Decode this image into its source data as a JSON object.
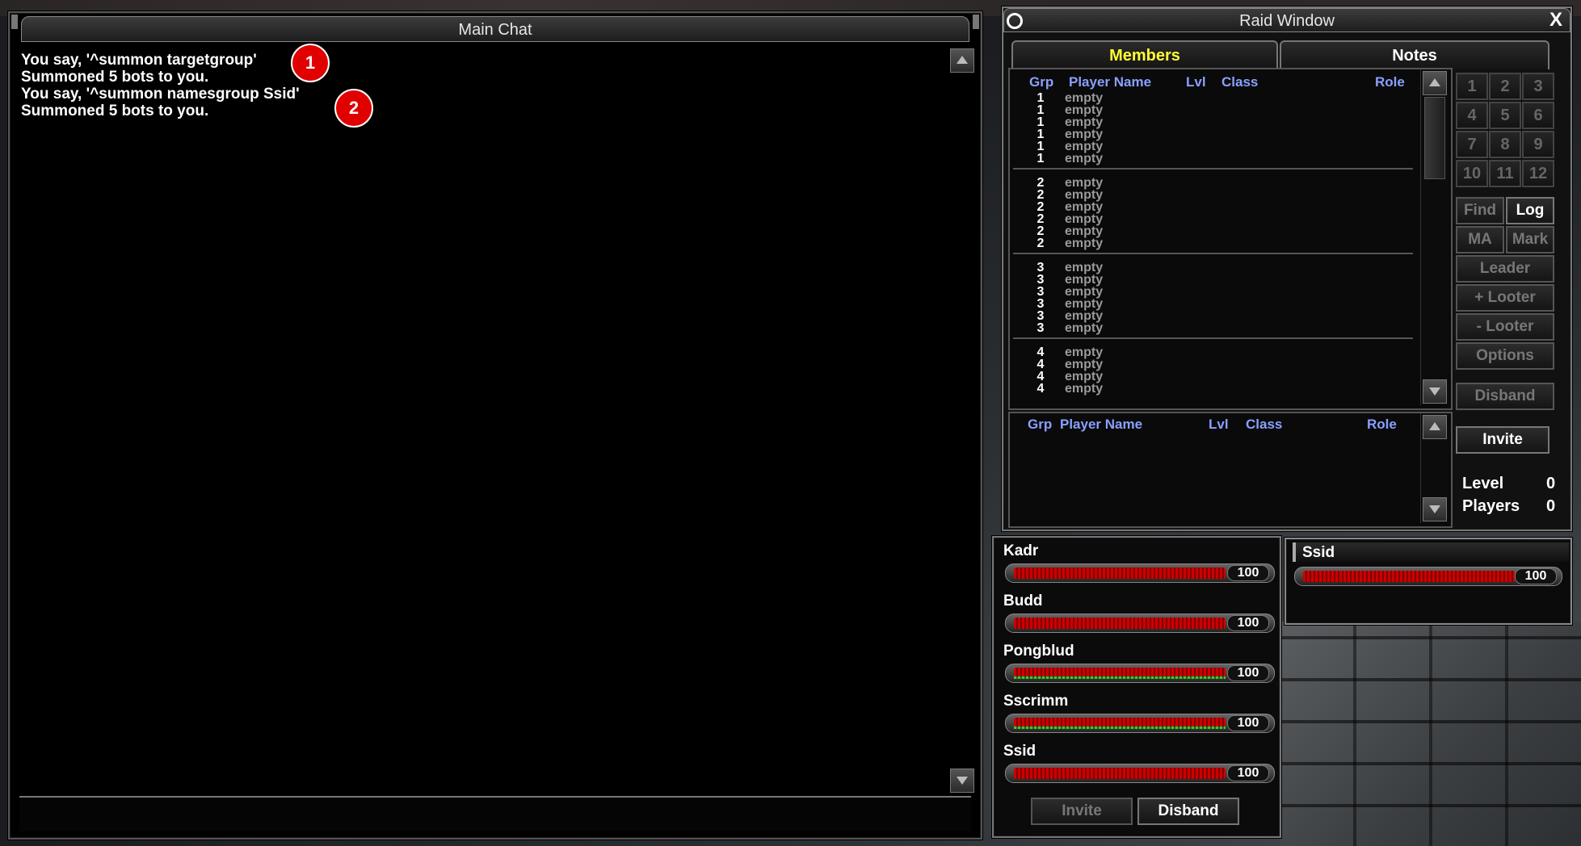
{
  "chat": {
    "title": "Main Chat",
    "lines": [
      "You say, '^summon targetgroup'",
      "Summoned 5 bots to you.",
      "You say, '^summon namesgroup Ssid'",
      "Summoned 5 bots to you."
    ],
    "markers": [
      "1",
      "2"
    ]
  },
  "raid": {
    "title": "Raid Window",
    "close": "X",
    "tabs": {
      "members": "Members",
      "notes": "Notes"
    },
    "columns": {
      "grp": "Grp",
      "player_name": "Player Name",
      "lvl": "Lvl",
      "class": "Class",
      "role": "Role"
    },
    "groups": [
      {
        "num": "1",
        "rows": [
          "empty",
          "empty",
          "empty",
          "empty",
          "empty",
          "empty"
        ]
      },
      {
        "num": "2",
        "rows": [
          "empty",
          "empty",
          "empty",
          "empty",
          "empty",
          "empty"
        ]
      },
      {
        "num": "3",
        "rows": [
          "empty",
          "empty",
          "empty",
          "empty",
          "empty",
          "empty"
        ]
      },
      {
        "num": "4",
        "rows": [
          "empty",
          "empty",
          "empty",
          "empty"
        ]
      }
    ],
    "group_numbers": [
      "1",
      "2",
      "3",
      "4",
      "5",
      "6",
      "7",
      "8",
      "9",
      "10",
      "11",
      "12"
    ],
    "buttons": {
      "find": "Find",
      "log": "Log",
      "ma": "MA",
      "mark": "Mark",
      "leader": "Leader",
      "add_looter": "+ Looter",
      "remove_looter": "- Looter",
      "options": "Options",
      "disband": "Disband",
      "invite": "Invite"
    },
    "stats": {
      "level_label": "Level",
      "level_value": "0",
      "players_label": "Players",
      "players_value": "0"
    }
  },
  "group": {
    "members": [
      {
        "name": "Kadr",
        "hp": "100"
      },
      {
        "name": "Budd",
        "hp": "100"
      },
      {
        "name": "Pongblud",
        "hp": "100"
      },
      {
        "name": "Sscrimm",
        "hp": "100"
      },
      {
        "name": "Ssid",
        "hp": "100"
      }
    ],
    "invite": "Invite",
    "disband": "Disband"
  },
  "target": {
    "name": "Ssid",
    "hp": "100"
  },
  "colors": {
    "hp_red": "#cc0000",
    "tab_active": "#ffff33",
    "column_header": "#8aa0ff",
    "marker": "#e00000"
  }
}
